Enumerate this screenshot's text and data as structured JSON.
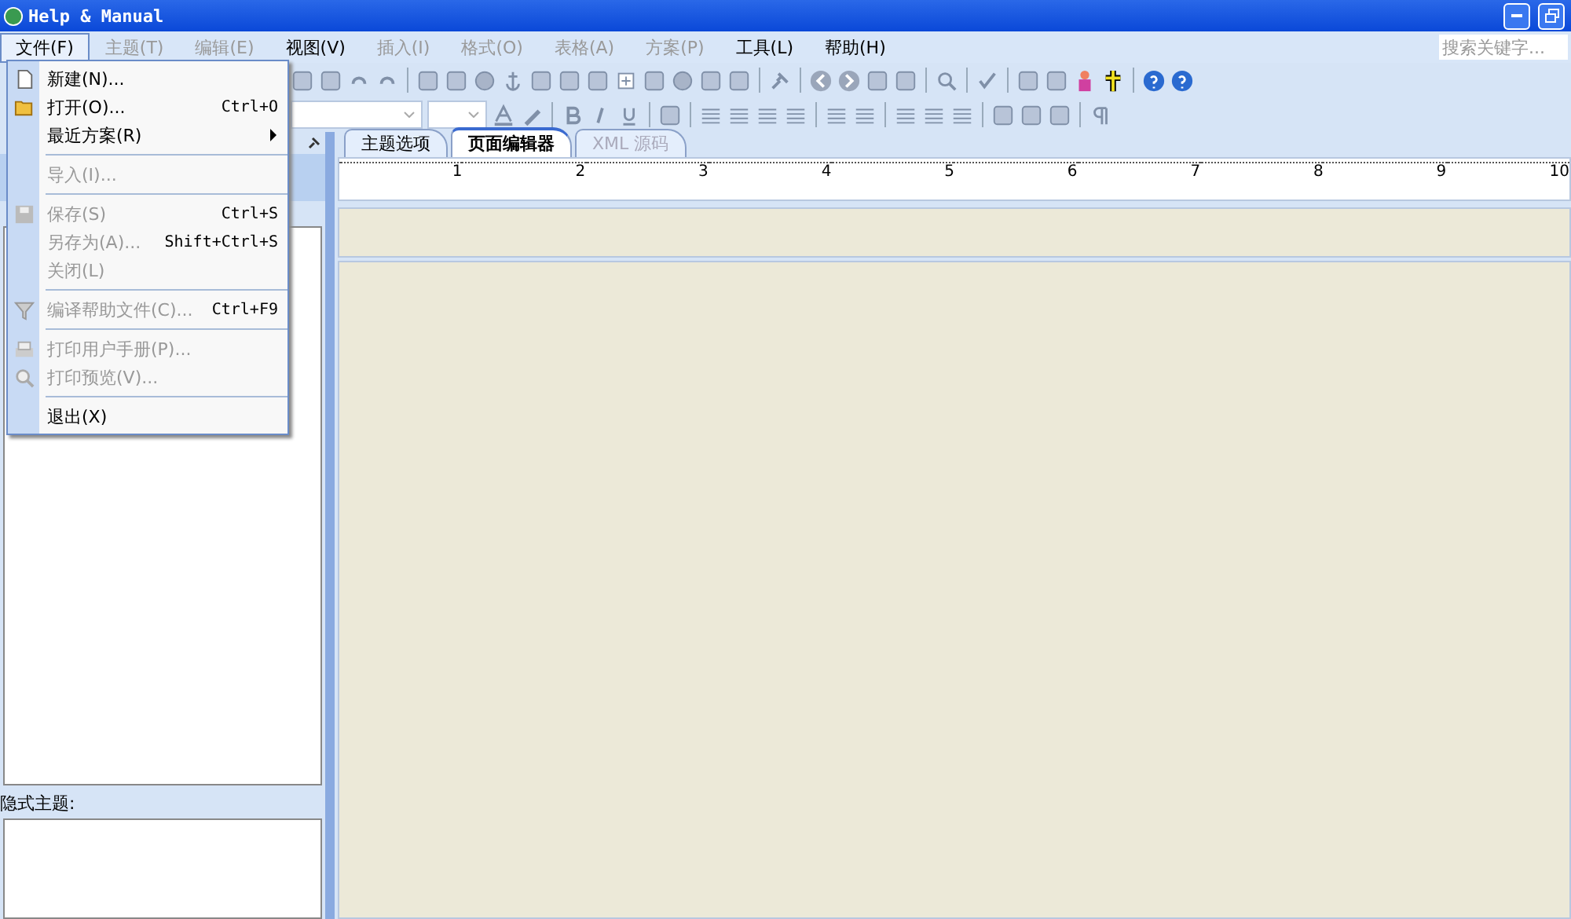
{
  "window": {
    "title": "Help & Manual",
    "search": {
      "placeholder": "搜索关键字..."
    }
  },
  "menu_bar": [
    {
      "label": "文件(F)",
      "selected": true,
      "disabled": false
    },
    {
      "label": "主题(T)",
      "selected": false,
      "disabled": true
    },
    {
      "label": "编辑(E)",
      "selected": false,
      "disabled": true
    },
    {
      "label": "视图(V)",
      "selected": false,
      "disabled": false
    },
    {
      "label": "插入(I)",
      "selected": false,
      "disabled": true
    },
    {
      "label": "格式(O)",
      "selected": false,
      "disabled": true
    },
    {
      "label": "表格(A)",
      "selected": false,
      "disabled": true
    },
    {
      "label": "方案(P)",
      "selected": false,
      "disabled": true
    },
    {
      "label": "工具(L)",
      "selected": false,
      "disabled": false
    },
    {
      "label": "帮助(H)",
      "selected": false,
      "disabled": false
    }
  ],
  "file_menu": [
    {
      "kind": "item",
      "label": "新建(N)...",
      "disabled": false
    },
    {
      "kind": "item",
      "label": "打开(O)...",
      "shortcut": "Ctrl+O",
      "disabled": false
    },
    {
      "kind": "submenu",
      "label": "最近方案(R)",
      "disabled": false
    },
    {
      "kind": "separator"
    },
    {
      "kind": "item",
      "label": "导入(I)...",
      "disabled": true
    },
    {
      "kind": "separator"
    },
    {
      "kind": "item",
      "label": "保存(S)",
      "shortcut": "Ctrl+S",
      "disabled": true
    },
    {
      "kind": "item",
      "label": "另存为(A)...",
      "shortcut": "Shift+Ctrl+S",
      "disabled": true
    },
    {
      "kind": "item",
      "label": "关闭(L)",
      "disabled": true
    },
    {
      "kind": "separator"
    },
    {
      "kind": "item",
      "label": "编译帮助文件(C)...",
      "shortcut": "Ctrl+F9",
      "disabled": true
    },
    {
      "kind": "separator"
    },
    {
      "kind": "item",
      "label": "打印用户手册(P)...",
      "disabled": true
    },
    {
      "kind": "item",
      "label": "打印预览(V)...",
      "disabled": true
    },
    {
      "kind": "separator"
    },
    {
      "kind": "item",
      "label": "退出(X)",
      "disabled": false
    }
  ],
  "editor_tabs": [
    {
      "label": "主题选项",
      "selected": false,
      "disabled": false
    },
    {
      "label": "页面编辑器",
      "selected": true,
      "disabled": false
    },
    {
      "label": "XML 源码",
      "selected": false,
      "disabled": true
    }
  ],
  "ruler": {
    "numbers": [
      "1",
      "2",
      "3",
      "4",
      "5",
      "6",
      "7",
      "8",
      "9",
      "10"
    ]
  },
  "left_panel": {
    "hidden_topics_label": "隐式主题:"
  }
}
